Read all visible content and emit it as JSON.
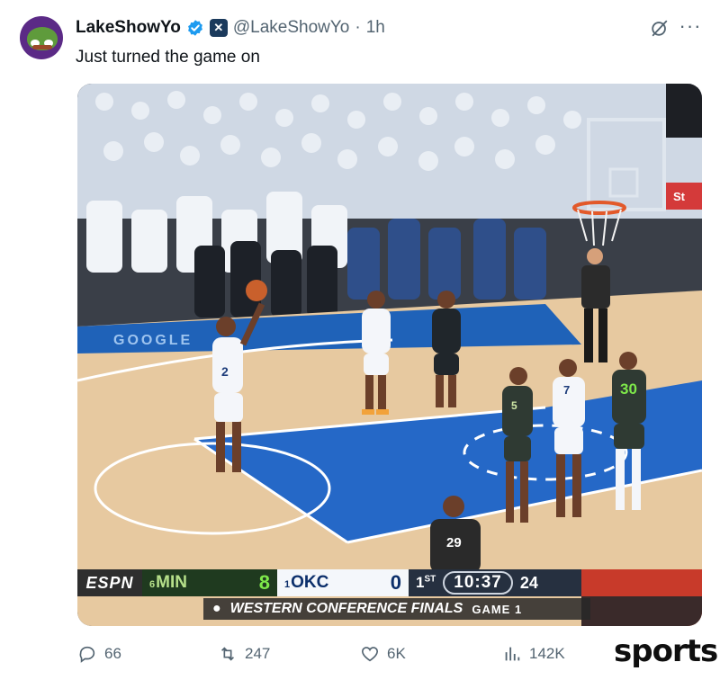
{
  "tweet": {
    "display_name": "LakeShowYo",
    "handle": "@LakeShowYo",
    "separator": "·",
    "time": "1h",
    "text": "Just turned the game on",
    "more_label": "···",
    "avatar_icon": "pepe-frog-lakers-avatar",
    "verified_icon": "verified-badge-icon",
    "affiliate_icon": "x-affiliate-badge-icon",
    "colors": {
      "verified": "#1d9bf0",
      "muted": "#536471"
    }
  },
  "media": {
    "scorebug": {
      "network": "ESPN",
      "team1_seed": "6",
      "team1": "MIN",
      "team1_score": "8",
      "team2_seed": "1",
      "team2": "OKC",
      "team2_score": "0",
      "quarter_num": "1",
      "quarter_suffix": "ST",
      "clock": "10:37",
      "shot_clock": "24"
    },
    "subtitle": "WESTERN CONFERENCE FINALS",
    "game": "GAME 1",
    "jerseys": {
      "shooter": "2",
      "okc_near_lane": "7",
      "min_near_lane": "5",
      "min_right": "30",
      "referee": "29"
    },
    "court_text": "GOOGLE",
    "sign_text": "St"
  },
  "actions": {
    "replies": "66",
    "reposts": "247",
    "likes": "6K",
    "views": "142K"
  },
  "watermark": "sports"
}
